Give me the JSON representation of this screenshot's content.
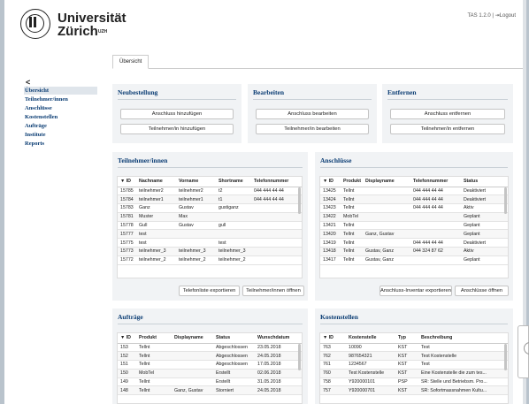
{
  "header": {
    "logo_line1": "Universität",
    "logo_line2": "Zürich",
    "logo_sup": "UZH",
    "version": "TAS 1.2.0",
    "logout_icon": "logout-icon",
    "logout_label": "Logout"
  },
  "tabs": [
    {
      "label": "Übersicht"
    }
  ],
  "sidebar": {
    "back_icon": "chevron-left-icon",
    "back_label": "<",
    "items": [
      {
        "label": "Übersicht"
      },
      {
        "label": "Teilnehmer/innen"
      },
      {
        "label": "Anschlüsse"
      },
      {
        "label": "Kostenstellen"
      },
      {
        "label": "Aufträge"
      },
      {
        "label": "Institute"
      },
      {
        "label": "Reports"
      }
    ]
  },
  "neubestellung": {
    "title": "Neubestellung",
    "btn1": "Anschluss hinzufügen",
    "btn2": "Teilnehmer/in hinzufügen"
  },
  "bearbeiten": {
    "title": "Bearbeiten",
    "btn1": "Anschluss bearbeiten",
    "btn2": "Teilnehmer/in bearbeiten"
  },
  "entfernen": {
    "title": "Entfernen",
    "btn1": "Anschluss entfernen",
    "btn2": "Teilnehmer/in entfernen"
  },
  "teilnehmer": {
    "title": "Teilnehmer/innen",
    "columns": [
      "▼ ID",
      "Nachname",
      "Vorname",
      "Shortname",
      "Telefonnummer"
    ],
    "rows": [
      [
        "15785",
        "teilnehmer2",
        "teilnehmer2",
        "t2",
        "044 444 44 44"
      ],
      [
        "15784",
        "teilnehmer1",
        "teilnehmer1",
        "t1",
        "044 444 44 44"
      ],
      [
        "15783",
        "Ganz",
        "Gustav",
        "gustiganz",
        ""
      ],
      [
        "15781",
        "Muster",
        "Max",
        "",
        ""
      ],
      [
        "15778",
        "Gull",
        "Gustav",
        "gull",
        ""
      ],
      [
        "15777",
        "test",
        "",
        "",
        ""
      ],
      [
        "15775",
        "test",
        "",
        "test",
        ""
      ],
      [
        "15773",
        "teilnehmer_3",
        "teilnehmer_3",
        "teilnehmer_3",
        ""
      ],
      [
        "15772",
        "teilnehmer_2",
        "teilnehmer_2",
        "teilnehmer_2",
        ""
      ]
    ],
    "btn_export": "Telefonliste exportieren",
    "btn_open": "Teilnehmer/innen öffnen"
  },
  "anschluesse": {
    "title": "Anschlüsse",
    "columns": [
      "▼ ID",
      "Produkt",
      "Displayname",
      "Telefonnummer",
      "Status"
    ],
    "rows": [
      [
        "13425",
        "Tellnt",
        "",
        "044 444 44 44",
        "Deaktiviert"
      ],
      [
        "13424",
        "Tellnt",
        "",
        "044 444 44 44",
        "Deaktiviert"
      ],
      [
        "13423",
        "Tellnt",
        "",
        "044 444 44 44",
        "Aktiv"
      ],
      [
        "13422",
        "MobTel",
        "",
        "",
        "Geplant"
      ],
      [
        "13421",
        "Tellnt",
        "",
        "",
        "Geplant"
      ],
      [
        "13420",
        "Tellnt",
        "Ganz, Gustav",
        "",
        "Geplant"
      ],
      [
        "13419",
        "Tellnt",
        "",
        "044 444 44 44",
        "Deaktiviert"
      ],
      [
        "13418",
        "Tellnt",
        "Gustav, Ganz",
        "044 324 87 62",
        "Aktiv"
      ],
      [
        "13417",
        "Tellnt",
        "Gustav, Ganz",
        "",
        "Geplant"
      ]
    ],
    "btn_export": "Anschluss-Inventar exportieren",
    "btn_open": "Anschlüsse öffnen"
  },
  "auftraege": {
    "title": "Aufträge",
    "columns": [
      "▼ ID",
      "Produkt",
      "Displayname",
      "Status",
      "Wunschdatum"
    ],
    "rows": [
      [
        "153",
        "Tellnt",
        "",
        "Abgeschlossen",
        "23.05.2018"
      ],
      [
        "152",
        "Tellnt",
        "",
        "Abgeschlossen",
        "24.05.2018"
      ],
      [
        "151",
        "Tellnt",
        "",
        "Abgeschlossen",
        "17.05.2018"
      ],
      [
        "150",
        "MobTel",
        "",
        "Erstellt",
        "02.06.2018"
      ],
      [
        "149",
        "Tellnt",
        "",
        "Erstellt",
        "31.05.2018"
      ],
      [
        "148",
        "Tellnt",
        "Ganz, Gustav",
        "Storniert",
        "24.05.2018"
      ]
    ]
  },
  "kostenstellen": {
    "title": "Kostenstellen",
    "columns": [
      "▼ ID",
      "Kostenstelle",
      "Typ",
      "Beschreibung"
    ],
    "rows": [
      [
        "763",
        "10090",
        "KST",
        "Test"
      ],
      [
        "762",
        "987654321",
        "KST",
        "Test Kostenstelle"
      ],
      [
        "761",
        "1234567",
        "KST",
        "Test"
      ],
      [
        "760",
        "Test Kostenstelle",
        "KST",
        "Eine Kostenstelle die zum tes..."
      ],
      [
        "758",
        "Y920000101",
        "PSP",
        "SR: Stelle und Betriebsm. Pro..."
      ],
      [
        "757",
        "Y920000701",
        "KST",
        "SR: Sofortmassnahmen Kultu..."
      ]
    ]
  }
}
